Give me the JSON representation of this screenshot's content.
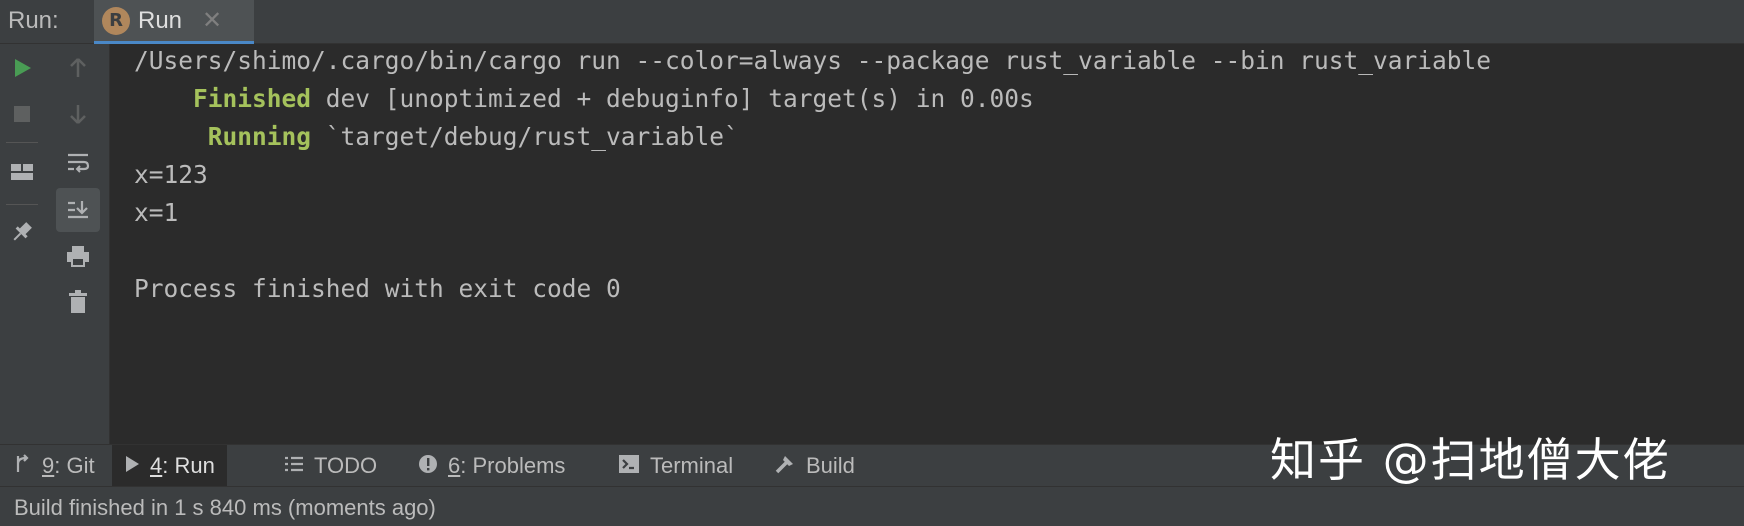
{
  "topbar": {
    "label": "Run:",
    "tab": {
      "icon_text": "R",
      "label": "Run",
      "close": "✕"
    }
  },
  "toolbar_left": [
    "play-icon",
    "stop-icon",
    "layout-icon",
    "pin-icon"
  ],
  "toolbar_right": [
    "up-arrow-icon",
    "down-arrow-icon",
    "soft-wrap-icon",
    "scroll-to-end-icon",
    "print-icon",
    "trash-icon"
  ],
  "console": {
    "line1": "/Users/shimo/.cargo/bin/cargo run --color=always --package rust_variable --bin rust_variable",
    "line2_keyword": "Finished",
    "line2_rest": " dev [unoptimized + debuginfo] target(s) in 0.00s",
    "line3_keyword": "Running",
    "line3_rest": " `target/debug/rust_variable`",
    "line4": "x=123",
    "line5": "x=1",
    "line6": "Process finished with exit code 0"
  },
  "bottom_tabs": [
    {
      "icon": "git-icon",
      "num": "9",
      "label": ": Git"
    },
    {
      "icon": "run-icon",
      "num": "4",
      "label": ": Run"
    },
    {
      "icon": "todo-icon",
      "num": "",
      "label": "TODO"
    },
    {
      "icon": "problems-icon",
      "num": "6",
      "label": ": Problems"
    },
    {
      "icon": "terminal-icon",
      "num": "",
      "label": "Terminal"
    },
    {
      "icon": "build-icon",
      "num": "",
      "label": "Build"
    }
  ],
  "watermark": "知乎 @扫地僧大佬",
  "status": "Build finished in 1 s 840 ms (moments ago)",
  "colors": {
    "accent": "#4a88c7",
    "green_keyword": "#a5c25c",
    "run_green": "#499c54"
  }
}
